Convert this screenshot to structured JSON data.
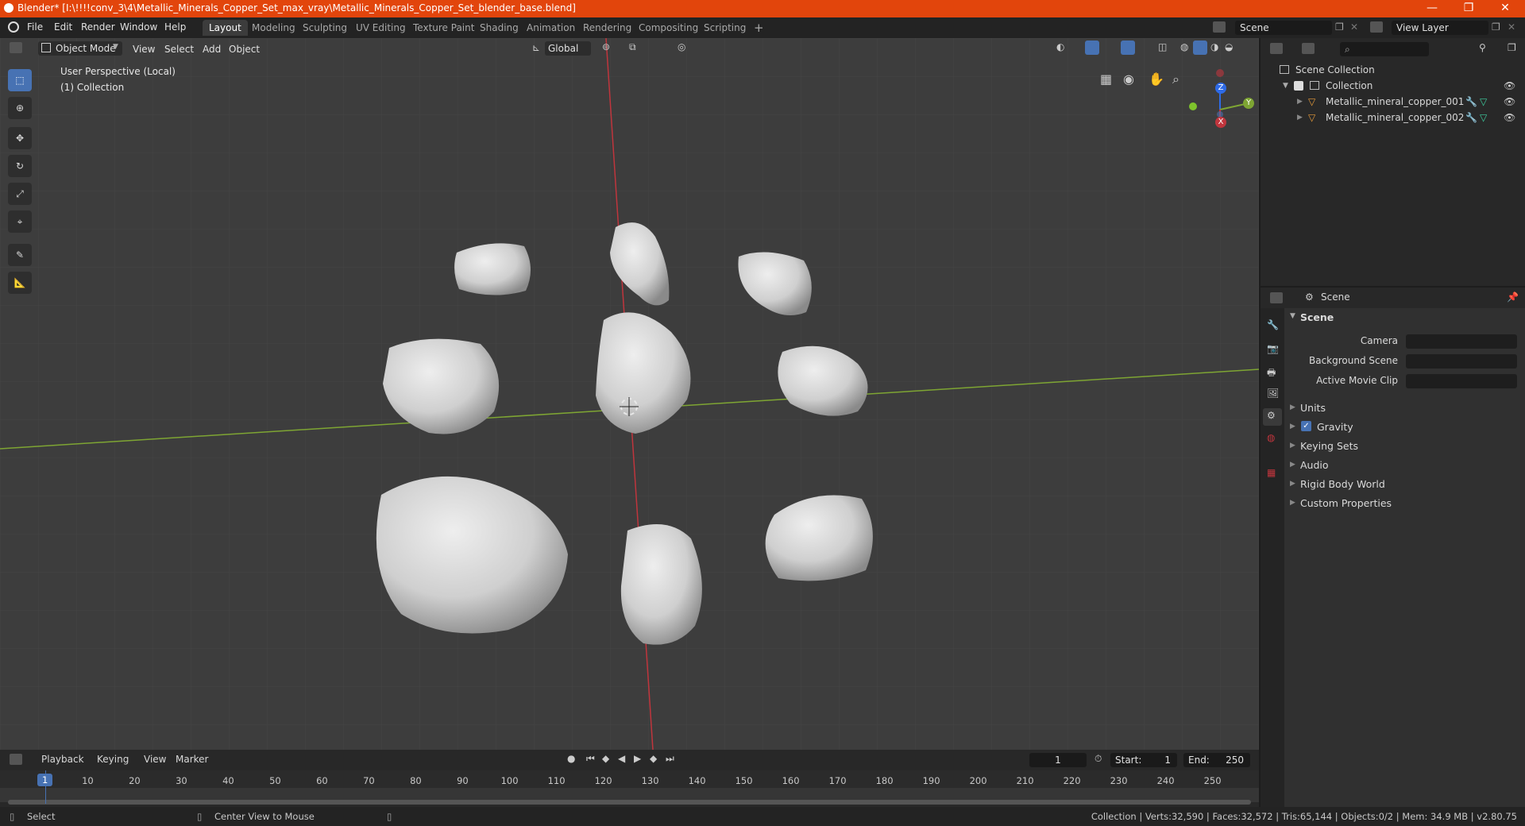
{
  "window": {
    "title": "Blender* [I:\\!!!!conv_3\\4\\Metallic_Minerals_Copper_Set_max_vray\\Metallic_Minerals_Copper_Set_blender_base.blend]",
    "controls": [
      "—",
      "❐",
      "✕"
    ]
  },
  "menu": [
    "File",
    "Edit",
    "Render",
    "Window",
    "Help"
  ],
  "workspaces": {
    "tabs": [
      "Layout",
      "Modeling",
      "Sculpting",
      "UV Editing",
      "Texture Paint",
      "Shading",
      "Animation",
      "Rendering",
      "Compositing",
      "Scripting"
    ],
    "active": "Layout",
    "add": "+"
  },
  "scene_selector": {
    "value": "Scene"
  },
  "view_layer_selector": {
    "value": "View Layer"
  },
  "viewport_header": {
    "mode": "Object Mode",
    "menus": [
      "View",
      "Select",
      "Add",
      "Object"
    ],
    "orientation": "Global"
  },
  "viewport": {
    "overlay_line1": "User Perspective (Local)",
    "overlay_line2": "(1) Collection",
    "gizmo_axes": [
      "Z",
      "Y",
      "X"
    ]
  },
  "outliner": {
    "root": "Scene Collection",
    "collection": "Collection",
    "objects": [
      "Metallic_mineral_copper_001",
      "Metallic_mineral_copper_002"
    ]
  },
  "properties": {
    "header": "Scene",
    "section": "Scene",
    "fields": [
      {
        "label": "Camera"
      },
      {
        "label": "Background Scene"
      },
      {
        "label": "Active Movie Clip"
      }
    ],
    "panels": [
      "Units",
      "Gravity",
      "Keying Sets",
      "Audio",
      "Rigid Body World",
      "Custom Properties"
    ],
    "gravity_checked": true
  },
  "timeline": {
    "menus": [
      "Playback",
      "Keying",
      "View",
      "Marker"
    ],
    "current_frame": "1",
    "start_label": "Start:",
    "start": "1",
    "end_label": "End:",
    "end": "250",
    "ticks": [
      "1",
      "10",
      "20",
      "30",
      "40",
      "50",
      "60",
      "70",
      "80",
      "90",
      "100",
      "110",
      "120",
      "130",
      "140",
      "150",
      "160",
      "170",
      "180",
      "190",
      "200",
      "210",
      "220",
      "230",
      "240",
      "250"
    ]
  },
  "status_bar": {
    "left": "Select",
    "middle": "Center View to Mouse",
    "right": "Collection | Verts:32,590 | Faces:32,572 | Tris:65,144 | Objects:0/2 | Mem: 34.9 MB | v2.80.75"
  },
  "colors": {
    "titlebar": "#e2450c",
    "viewport_bg": "#3d3d3d",
    "accent": "#4772b3",
    "x_axis": "#c0353d",
    "y_axis": "#7ea533",
    "z_axis": "#2e6ae6"
  }
}
